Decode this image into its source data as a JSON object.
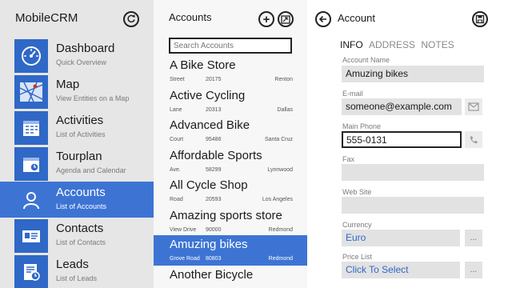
{
  "nav": {
    "app_title": "MobileCRM",
    "items": [
      {
        "label": "Dashboard",
        "sub": "Quick Overview"
      },
      {
        "label": "Map",
        "sub": "View Entities on a Map"
      },
      {
        "label": "Activities",
        "sub": "List of Activities"
      },
      {
        "label": "Tourplan",
        "sub": "Agenda and Calendar"
      },
      {
        "label": "Accounts",
        "sub": "List of Accounts"
      },
      {
        "label": "Contacts",
        "sub": "List of Contacts"
      },
      {
        "label": "Leads",
        "sub": "List of Leads"
      }
    ],
    "active_index": 4
  },
  "accounts": {
    "title": "Accounts",
    "search_placeholder": "Search Accounts",
    "items": [
      {
        "name": "A Bike Store",
        "street": "Street",
        "zip": "20175",
        "city": "Renton"
      },
      {
        "name": "Active Cycling",
        "street": "Lane",
        "zip": "20313",
        "city": "Dallas"
      },
      {
        "name": "Advanced Bike",
        "street": "Court",
        "zip": "95486",
        "city": "Santa Cruz"
      },
      {
        "name": "Affordable Sports",
        "street": "Ave.",
        "zip": "58299",
        "city": "Lynnwood"
      },
      {
        "name": "All Cycle Shop",
        "street": "Road",
        "zip": "20593",
        "city": "Los Angeles"
      },
      {
        "name": "Amazing sports store",
        "street": "View Drive",
        "zip": "90000",
        "city": "Redmond"
      },
      {
        "name": "Amuzing bikes",
        "street": "Grove Road",
        "zip": "80803",
        "city": "Redmond"
      },
      {
        "name": "Another Bicycle",
        "street": "",
        "zip": "",
        "city": ""
      }
    ],
    "active_index": 6
  },
  "detail": {
    "title": "Account",
    "tabs": [
      "INFO",
      "ADDRESS",
      "NOTES"
    ],
    "active_tab": 0,
    "fields": {
      "account_name": {
        "label": "Account Name",
        "value": "Amuzing bikes"
      },
      "email": {
        "label": "E-mail",
        "value": "someone@example.com"
      },
      "main_phone": {
        "label": "Main Phone",
        "value": "555-0131"
      },
      "fax": {
        "label": "Fax",
        "value": ""
      },
      "web_site": {
        "label": "Web Site",
        "value": ""
      },
      "currency": {
        "label": "Currency",
        "value": "Euro"
      },
      "price_list": {
        "label": "Price List",
        "value": "Click To Select"
      }
    },
    "lookup_button_label": "..."
  },
  "colors": {
    "accent": "#3d74d4",
    "tile": "#2f68c7",
    "nav_bg": "#e6e6e6",
    "list_bg": "#f7f7f7",
    "field_bg": "#e2e2e2"
  },
  "icons": {
    "sync": "sync-icon",
    "add": "plus-icon",
    "export": "export-icon",
    "back": "back-arrow-icon",
    "save": "save-icon",
    "email": "envelope-icon",
    "phone": "phone-icon"
  }
}
